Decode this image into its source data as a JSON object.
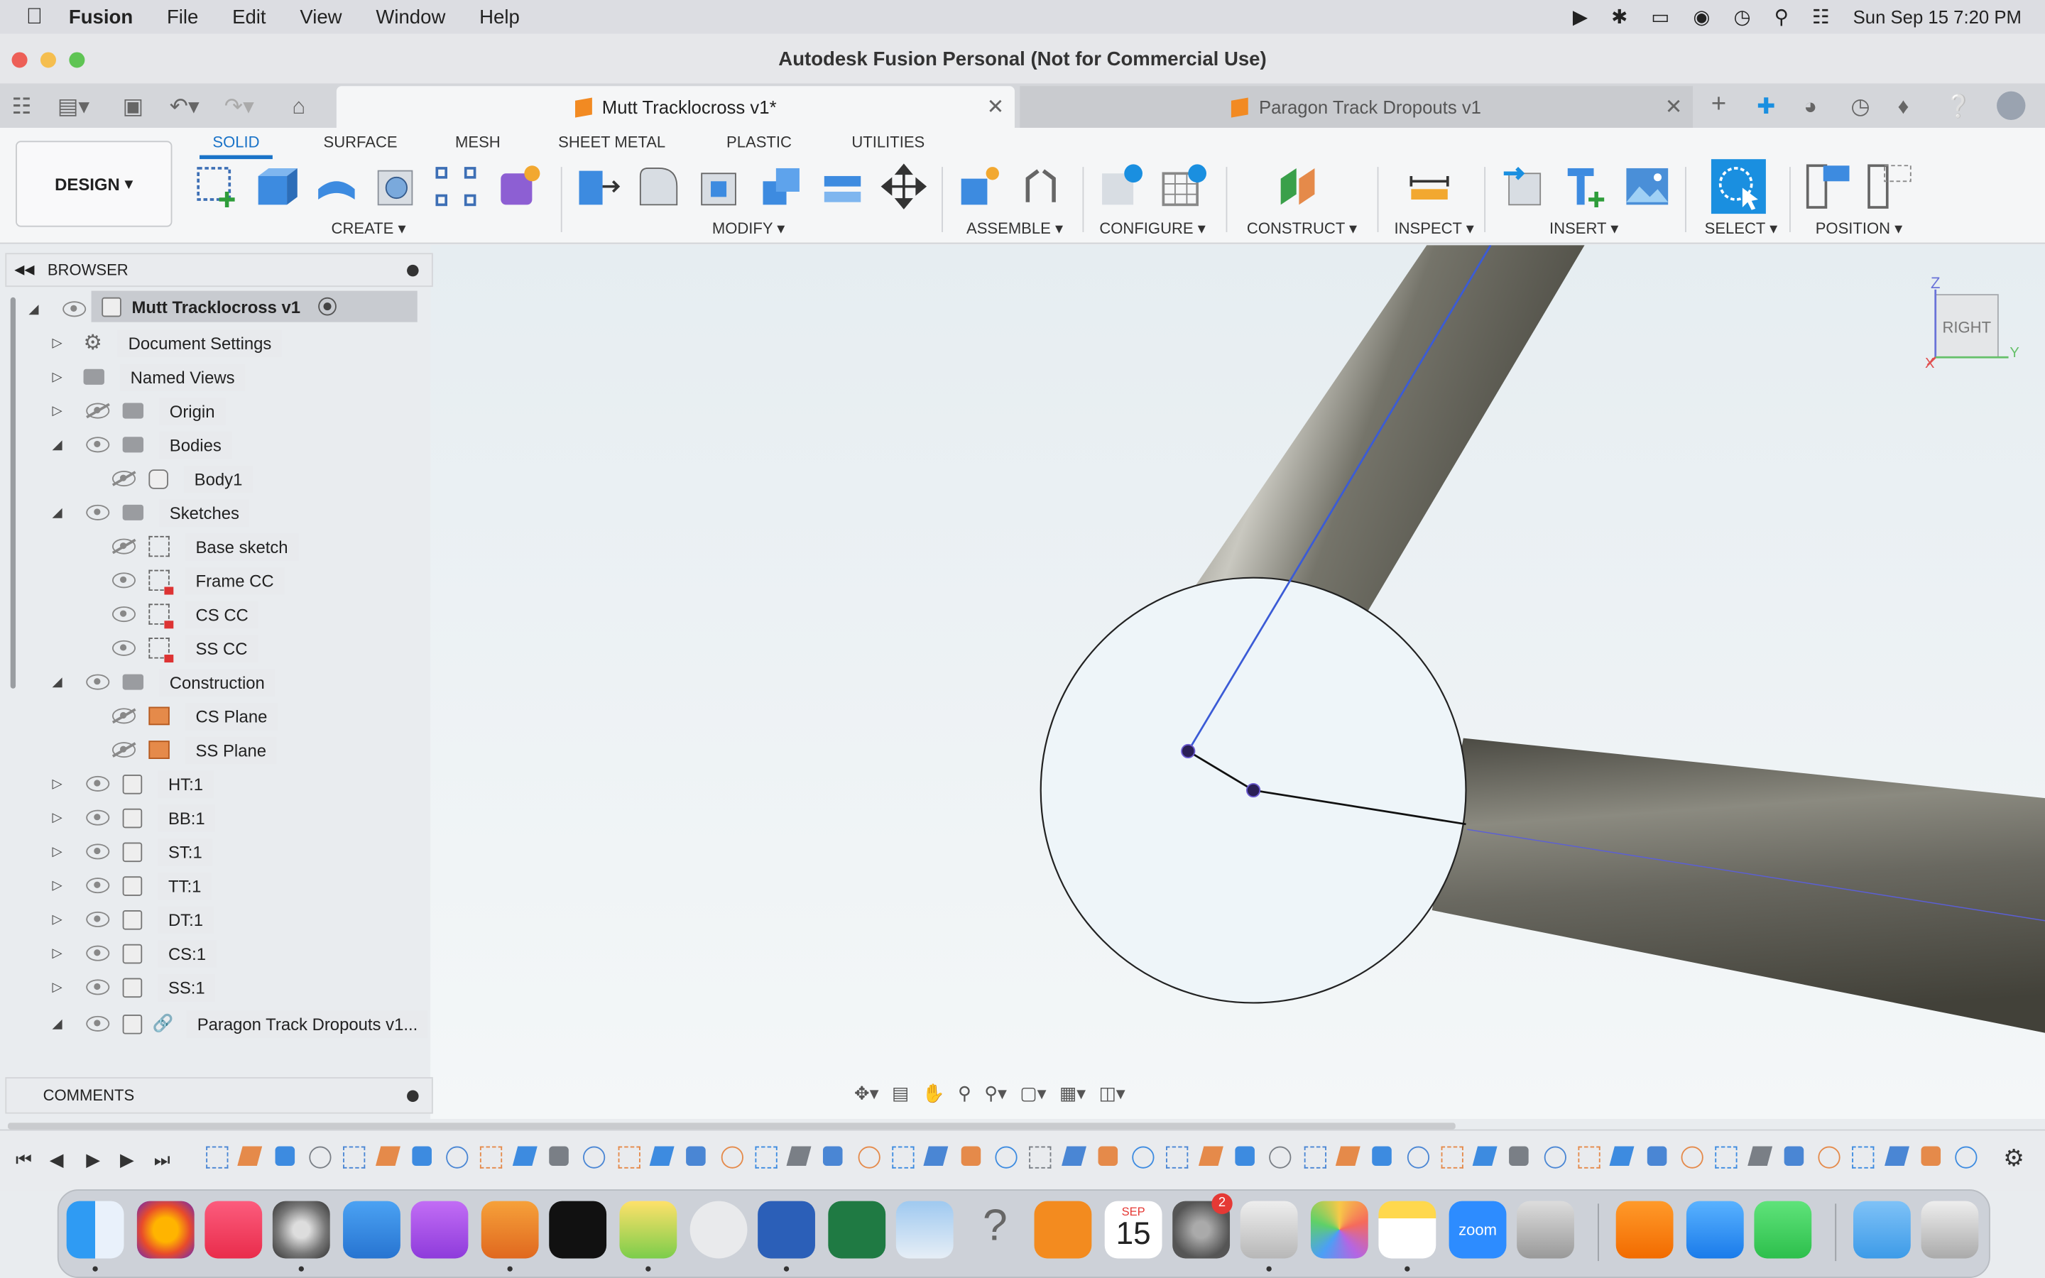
{
  "menubar": {
    "app": "Fusion",
    "items": [
      "File",
      "Edit",
      "View",
      "Window",
      "Help"
    ],
    "datetime": "Sun Sep 15  7:20 PM"
  },
  "window": {
    "title": "Autodesk Fusion Personal (Not for Commercial Use)"
  },
  "tabs": [
    {
      "label": "Mutt Tracklocross v1*",
      "active": true
    },
    {
      "label": "Paragon Track Dropouts v1",
      "active": false
    }
  ],
  "toolbar": {
    "workspace": "DESIGN",
    "workspace_tabs": [
      "SOLID",
      "SURFACE",
      "MESH",
      "SHEET METAL",
      "PLASTIC",
      "UTILITIES"
    ],
    "groups": [
      "CREATE",
      "MODIFY",
      "ASSEMBLE",
      "CONFIGURE",
      "CONSTRUCT",
      "INSPECT",
      "INSERT",
      "SELECT",
      "POSITION"
    ]
  },
  "browser": {
    "title": "BROWSER",
    "root": "Mutt Tracklocross v1",
    "items": [
      "Document Settings",
      "Named Views",
      "Origin",
      "Bodies",
      "Body1",
      "Sketches",
      "Base sketch",
      "Frame CC",
      "CS CC",
      "SS CC",
      "Construction",
      "CS Plane",
      "SS Plane",
      "HT:1",
      "BB:1",
      "ST:1",
      "TT:1",
      "DT:1",
      "CS:1",
      "SS:1",
      "Paragon Track Dropouts v1..."
    ]
  },
  "comments": {
    "title": "COMMENTS"
  },
  "viewcube": {
    "face": "RIGHT",
    "z": "Z",
    "x": "X",
    "y": "Y"
  },
  "dock": {
    "calendar_month": "SEP",
    "calendar_day": "15",
    "settings_badge": "2",
    "zoom_label": "zoom"
  },
  "colors": {
    "accent": "#1a73c8",
    "tube": "#6f6d63",
    "viewport_bg": "#eef3f6",
    "sketch_line": "#3b5bd6"
  }
}
